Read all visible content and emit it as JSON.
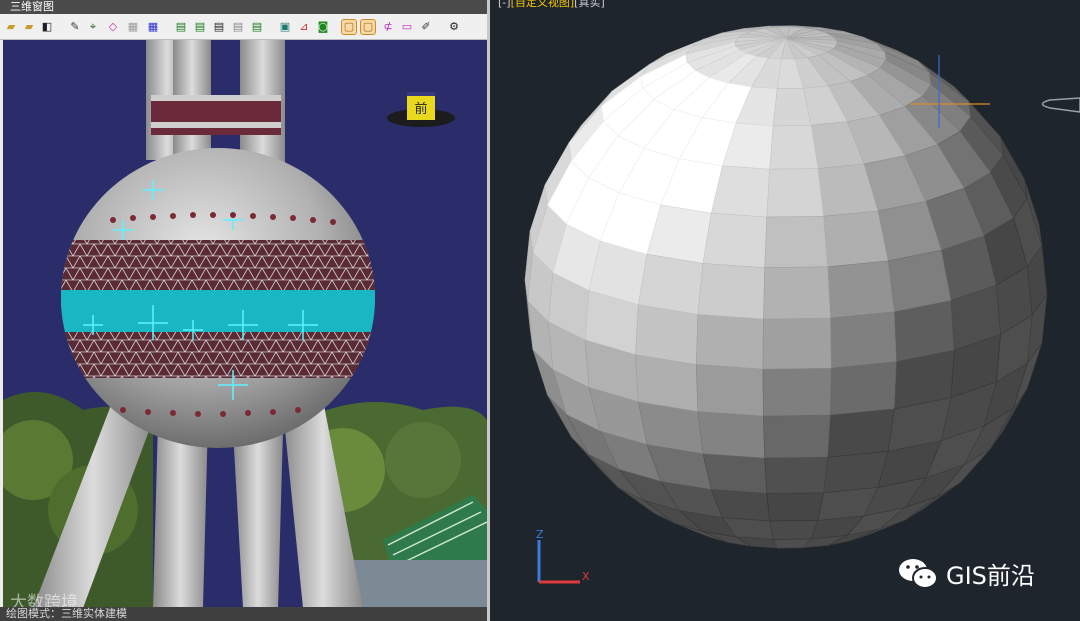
{
  "left_panel": {
    "title": "三维窗图",
    "status_text": "绘图模式：三维实体建模",
    "nav_cube_label": "前",
    "watermark": "大数跨境",
    "toolbar": {
      "icons": [
        "open-folder-icon",
        "folder-icon",
        "find-icon",
        "draw-icon",
        "select-icon",
        "box-icon",
        "grid-icon",
        "matrix-icon",
        "layer-icon",
        "layer-add-icon",
        "layer-del-icon",
        "layer-hide-icon",
        "layer-show-icon",
        "cube-icon",
        "axis-icon",
        "camera-icon",
        "object-mode-icon",
        "solid-mode-icon",
        "edit-icon",
        "window-icon",
        "property-icon",
        "settings-icon"
      ],
      "active": [
        "object-mode-icon",
        "solid-mode-icon"
      ]
    }
  },
  "right_panel": {
    "viewport_label_prefix": "[-]",
    "viewport_label_view": "[自定义视图]",
    "viewport_label_style": "[真实]",
    "axis_z_label": "Z",
    "axis_x_label": "X",
    "brand_text": "GIS前沿"
  },
  "colors": {
    "left_bg": "#2b2d6a",
    "right_bg": "#1f252d",
    "accent_yellow": "#f4c400",
    "axis_z": "#3a7be0",
    "axis_x": "#e03a3a",
    "crosshair_h": "#e08a2a",
    "crosshair_v": "#3a6ad0"
  }
}
